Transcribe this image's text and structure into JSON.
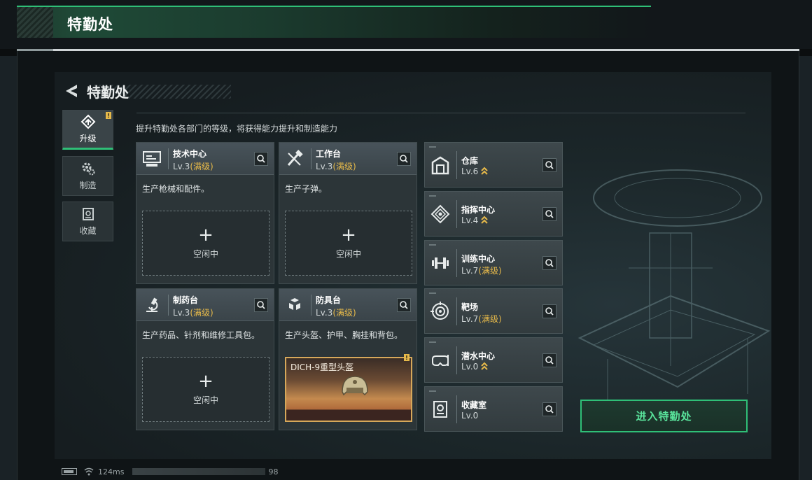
{
  "header": {
    "title": "特勤处"
  },
  "screen": {
    "back_title": "特勤处",
    "subtitle": "提升特勤处各部门的等级，将获得能力提升和制造能力",
    "enter_button": "进入特勤处"
  },
  "sidebar": {
    "tabs": [
      {
        "label": "升级",
        "icon": "upgrade-icon",
        "active": true,
        "badge": "!"
      },
      {
        "label": "制造",
        "icon": "gear-icon",
        "active": false
      },
      {
        "label": "收藏",
        "icon": "collection-icon",
        "active": false
      }
    ]
  },
  "cards": [
    {
      "name": "技术中心",
      "level": "Lv.3",
      "max": "(满级)",
      "desc": "生产枪械和配件。",
      "slot": "空闲中",
      "icon": "tech-center-icon"
    },
    {
      "name": "工作台",
      "level": "Lv.3",
      "max": "(满级)",
      "desc": "生产子弹。",
      "slot": "空闲中",
      "icon": "workbench-icon"
    },
    {
      "name": "制药台",
      "level": "Lv.3",
      "max": "(满级)",
      "desc": "生产药品、针剂和维修工具包。",
      "slot": "空闲中",
      "icon": "pharmacy-icon"
    },
    {
      "name": "防具台",
      "level": "Lv.3",
      "max": "(满级)",
      "desc": "生产头盔、护甲、胸挂和背包。",
      "item": "DICH-9重型头盔",
      "item_badge": "!",
      "icon": "armor-bench-icon"
    }
  ],
  "departments": [
    {
      "name": "仓库",
      "level": "Lv.6",
      "max": "",
      "upgradable": true,
      "icon": "warehouse-icon"
    },
    {
      "name": "指挥中心",
      "level": "Lv.4",
      "max": "",
      "upgradable": true,
      "icon": "command-center-icon"
    },
    {
      "name": "训练中心",
      "level": "Lv.7",
      "max": "(满级)",
      "upgradable": false,
      "icon": "dumbbell-icon"
    },
    {
      "name": "靶场",
      "level": "Lv.7",
      "max": "(满级)",
      "upgradable": false,
      "icon": "target-icon"
    },
    {
      "name": "潜水中心",
      "level": "Lv.0",
      "max": "",
      "upgradable": true,
      "icon": "diving-mask-icon"
    },
    {
      "name": "收藏室",
      "level": "Lv.0",
      "max": "",
      "upgradable": false,
      "icon": "trophy-room-icon"
    }
  ],
  "status": {
    "ping": "124ms",
    "fps": "98"
  },
  "colors": {
    "accent": "#2fbf77",
    "max_level": "#e6b94a",
    "panel": "#2c3538"
  }
}
